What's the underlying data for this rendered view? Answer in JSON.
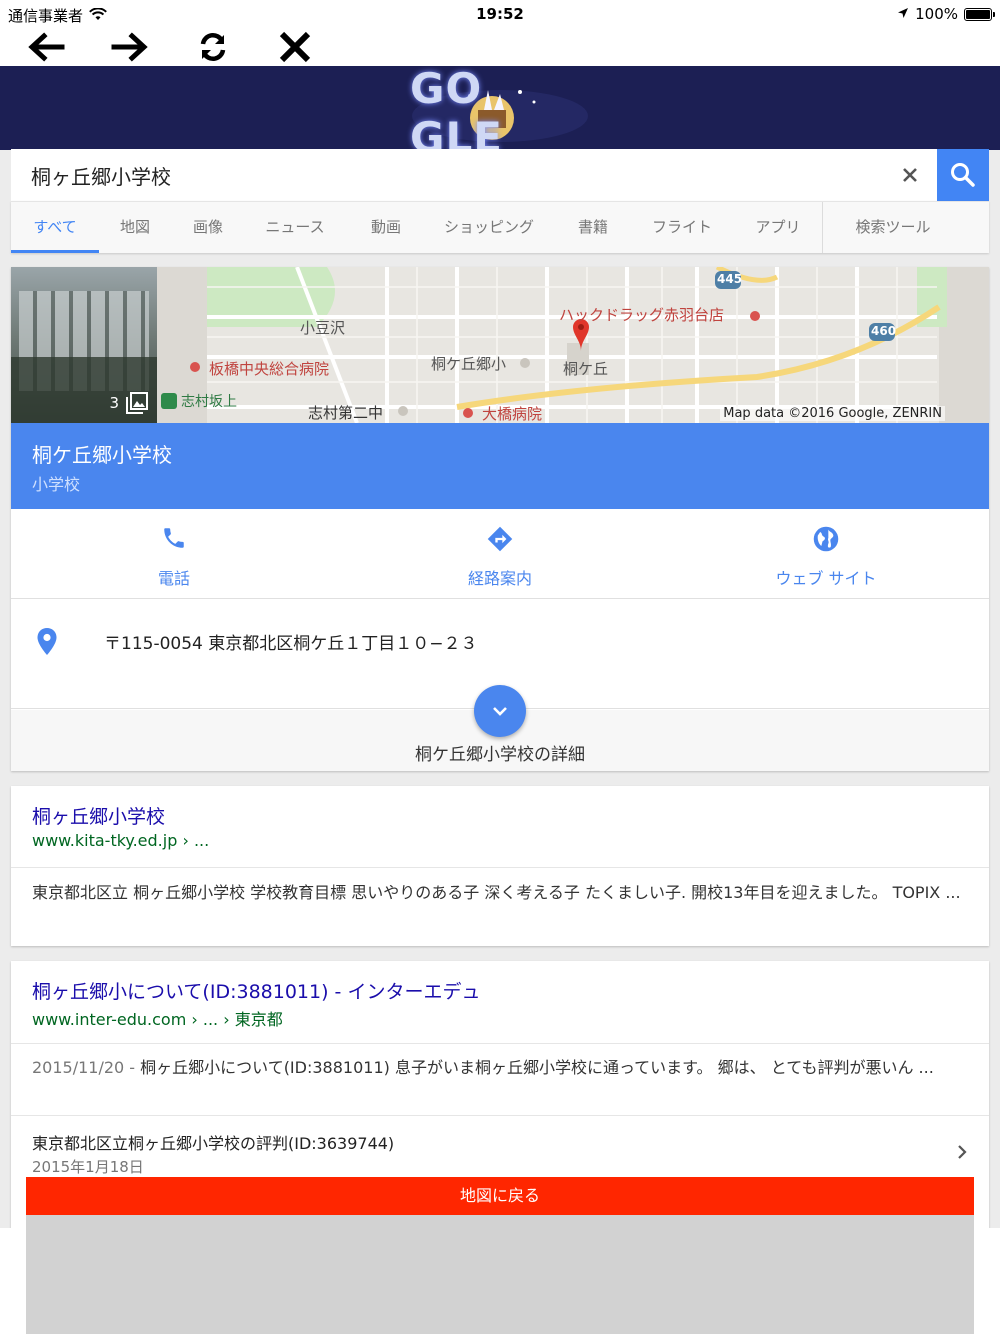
{
  "status_bar": {
    "carrier": "通信事業者",
    "time": "19:52",
    "battery": "100%",
    "battery_level": 1.0
  },
  "toolbar": {
    "icons": [
      "back-arrow-icon",
      "forward-arrow-icon",
      "refresh-icon",
      "close-icon"
    ]
  },
  "header": {
    "doodle_text": "GO GLE"
  },
  "search": {
    "query": "桐ヶ丘郷小学校"
  },
  "tabs": [
    {
      "label": "すべて",
      "active": true
    },
    {
      "label": "地図"
    },
    {
      "label": "画像"
    },
    {
      "label": "ニュース"
    },
    {
      "label": "動画"
    },
    {
      "label": "ショッピング"
    },
    {
      "label": "書籍"
    },
    {
      "label": "フライト"
    },
    {
      "label": "アプリ"
    },
    {
      "label": "検索ツール"
    }
  ],
  "knowledge_card": {
    "photo_count": "3",
    "map": {
      "labels": {
        "azuki": "小豆沢",
        "hospital": "板橋中央総合病院",
        "shimura_station": "志村坂上",
        "school_jh": "志村第二中",
        "ohashi": "大橋病院",
        "school": "桐ケ丘郷小",
        "kirigaoka": "桐ケ丘",
        "drug": "ハックドラッグ赤羽台店",
        "route445": "445",
        "route460": "460"
      },
      "attribution": "Map data ©2016 Google, ZENRIN"
    },
    "title": "桐ケ丘郷小学校",
    "subtitle": "小学校",
    "actions": {
      "phone": "電話",
      "directions": "経路案内",
      "website": "ウェブ サイト"
    },
    "address": "〒115-0054 東京都北区桐ケ丘１丁目１０−２３",
    "details": "桐ケ丘郷小学校の詳細"
  },
  "results": [
    {
      "title": "桐ヶ丘郷小学校",
      "url": "www.kita-tky.ed.jp › ...",
      "snippet": "東京都北区立 桐ヶ丘郷小学校 学校教育目標 思いやりのある子 深く考える子 たくましい子. 開校13年目を迎えました。 TOPIX ..."
    },
    {
      "title": "桐ヶ丘郷小について(ID:3881011) - インターエデュ",
      "url": "www.inter-edu.com › ... › 東京都",
      "date": "2015/11/20 - ",
      "snippet": "桐ヶ丘郷小について(ID:3881011) 息子がいま桐ヶ丘郷小学校に通っています。 郷は、 とても評判が悪いん ...",
      "sub_title": "東京都北区立桐ヶ丘郷小学校の評判(ID:3639744)",
      "sub_date": "2015年1月18日"
    }
  ],
  "overlay": {
    "back_to_map": "地図に戻る"
  },
  "colors": {
    "accent": "#4285f4",
    "card_bar": "#4a86ee",
    "header_bg": "#1c1f54",
    "back_button": "#ff2600",
    "link": "#1a0dab",
    "url": "#006621"
  }
}
